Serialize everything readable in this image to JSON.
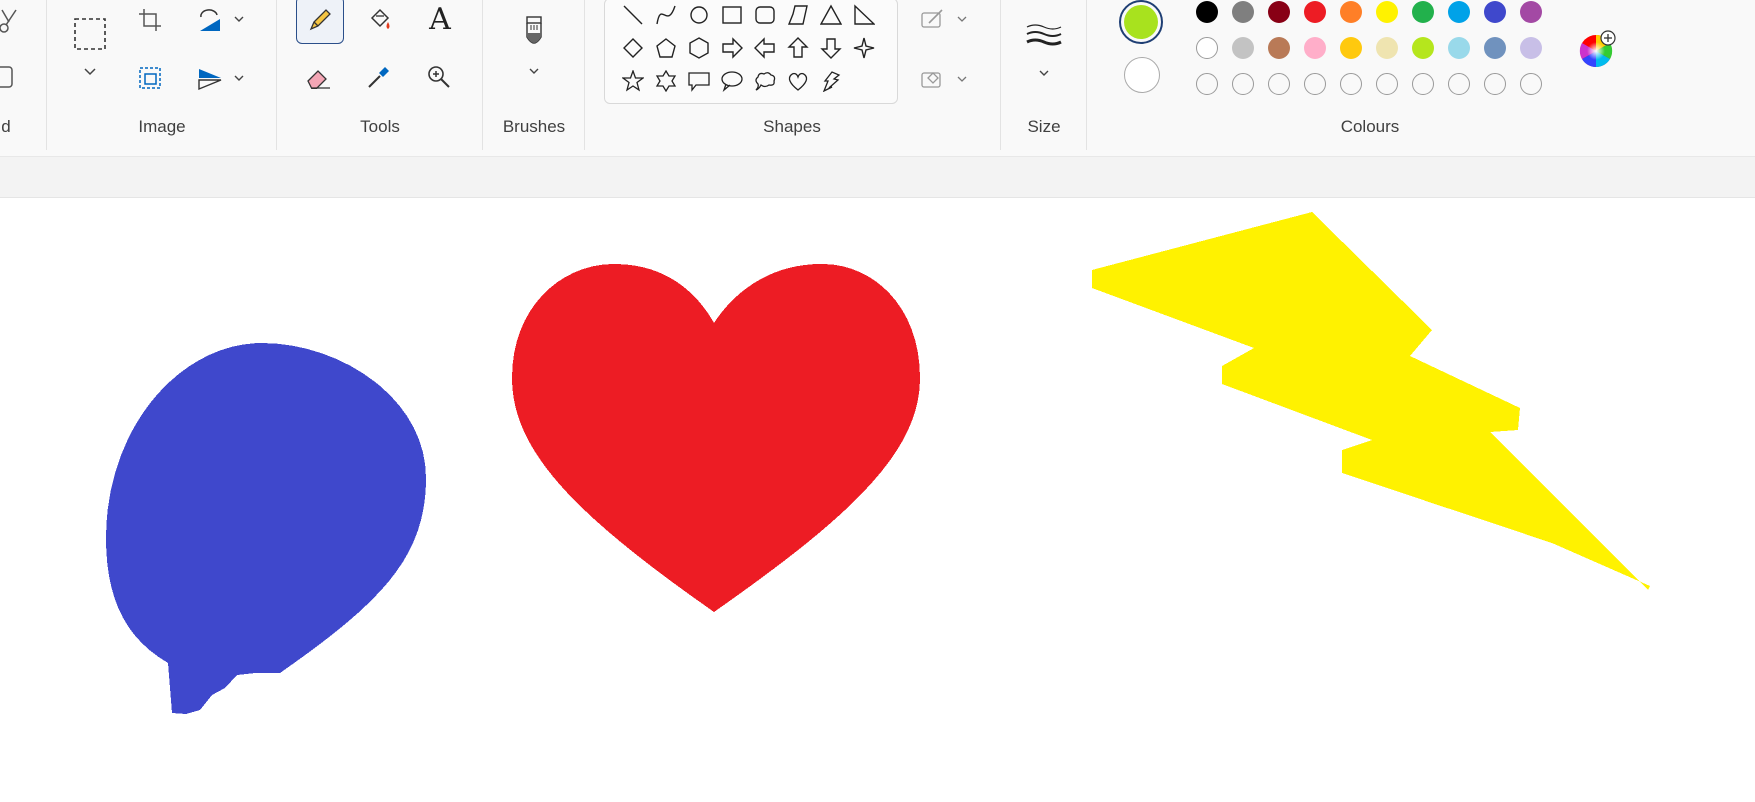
{
  "ribbon": {
    "groups": {
      "clipboard_partial": "d",
      "image": "Image",
      "tools": "Tools",
      "brushes": "Brushes",
      "shapes": "Shapes",
      "size": "Size",
      "colours": "Colours"
    },
    "tools": {
      "text_glyph": "A",
      "active_tool": "pencil"
    },
    "shapes_gallery": [
      "line",
      "curve",
      "oval",
      "rectangle",
      "rounded-rectangle",
      "polygon",
      "triangle",
      "right-triangle",
      "diamond",
      "pentagon",
      "hexagon",
      "right-arrow",
      "left-arrow",
      "up-arrow",
      "down-arrow",
      "four-point-star",
      "five-point-star",
      "six-point-star",
      "rectangular-callout",
      "oval-callout",
      "cloud-callout",
      "heart",
      "lightning"
    ]
  },
  "colours": {
    "primary": "#a8e21e",
    "secondary": "#ffffff",
    "palette_row1": [
      "#000000",
      "#7f7f7f",
      "#880015",
      "#ed1c24",
      "#ff7f27",
      "#fff200",
      "#22b14c",
      "#00a2e8",
      "#3f48cc",
      "#a349a4"
    ],
    "palette_row2": [
      "#ffffff",
      "#c3c3c3",
      "#b97a57",
      "#ffaec9",
      "#ffc90e",
      "#efe4b0",
      "#b5e61d",
      "#99d9ea",
      "#7092be",
      "#c8bfe7"
    ],
    "palette_row3": [
      "empty",
      "empty",
      "empty",
      "empty",
      "empty",
      "empty",
      "empty",
      "empty",
      "empty",
      "empty"
    ]
  },
  "canvas": {
    "shapes": [
      {
        "kind": "speech-bubble",
        "color": "#3f48cc"
      },
      {
        "kind": "heart",
        "color": "#ed1c24"
      },
      {
        "kind": "lightning",
        "color": "#fff200"
      }
    ]
  }
}
